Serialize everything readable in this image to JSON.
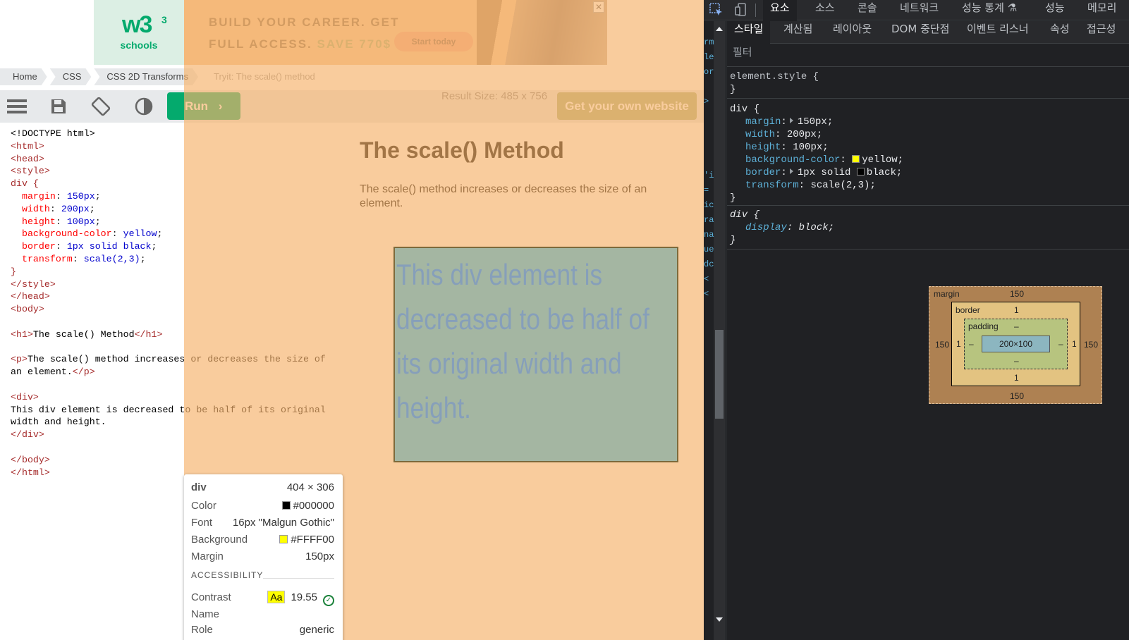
{
  "ad": {
    "logo_text": "w3",
    "logo_sup": "3",
    "logo_sub": "schools",
    "line1": "BUILD YOUR CAREER. GET",
    "line2": "FULL ACCESS.",
    "line2_save": "SAVE 770$",
    "cta": "Start today",
    "close": "✕"
  },
  "breadcrumb": [
    "Home",
    "CSS",
    "CSS 2D Transforms",
    "Tryit: The scale() method"
  ],
  "toolbar": {
    "run_label": "Run",
    "run_chevron": "›",
    "result_size": "Result Size: 485 x 756",
    "get_website": "Get your own website"
  },
  "code": {
    "l1": "<!DOCTYPE html>",
    "l2": "<html>",
    "l3": "<head>",
    "l4": "<style>",
    "l5": "div {",
    "l6p": "margin",
    "l6v": "150px",
    "l7p": "width",
    "l7v": "200px",
    "l8p": "height",
    "l8v": "100px",
    "l9p": "background-color",
    "l9v": "yellow",
    "l10p": "border",
    "l10v": "1px solid black",
    "l11p": "transform",
    "l11v": "scale(2,3)",
    "l12": "}",
    "l13": "</style>",
    "l14": "</head>",
    "l15": "<body>",
    "l16a": "<h1>",
    "l16b": "The scale() Method",
    "l16c": "</h1>",
    "l17a": "<p>",
    "l17b": "The scale() method increases or decreases the size of",
    "l18a": "an element.",
    "l18b": "</p>",
    "l19": "<div>",
    "l20": "This div element is decreased to be half of its original",
    "l21": "width and height.",
    "l22": "</div>",
    "l23": "</body>",
    "l24": "</html>"
  },
  "result": {
    "heading": "The scale() Method",
    "paragraph": "The scale() method increases or decreases the size of an element.",
    "div_text": "This div element is decreased to be half of its original width and height."
  },
  "tooltip": {
    "tag": "div",
    "dims": "404 × 306",
    "color_label": "Color",
    "color_value": "#000000",
    "font_label": "Font",
    "font_value": "16px \"Malgun Gothic\"",
    "bg_label": "Background",
    "bg_value": "#FFFF00",
    "margin_label": "Margin",
    "margin_value": "150px",
    "accessibility": "ACCESSIBILITY",
    "contrast_label": "Contrast",
    "contrast_chip": "Aa",
    "contrast_value": "19.55",
    "name_label": "Name",
    "role_label": "Role",
    "role_value": "generic",
    "colors": {
      "color": "#000000",
      "background": "#FFFF00"
    }
  },
  "devtools": {
    "top_tabs": [
      "요소",
      "소스",
      "콘솔",
      "네트워크",
      "성능 통계 ⚗",
      "성능",
      "메모리"
    ],
    "sub_tabs": [
      "스타일",
      "계산됨",
      "레이아웃",
      "DOM 중단점",
      "이벤트 리스너",
      "속성",
      "접근성"
    ],
    "filter_placeholder": "필터",
    "rule0_selector": "element.style {",
    "rule0_close": "}",
    "rule1_selector": "div {",
    "rule1": [
      {
        "name": "margin",
        "value": "150px;",
        "expand": true
      },
      {
        "name": "width",
        "value": "200px;"
      },
      {
        "name": "height",
        "value": "100px;"
      },
      {
        "name": "background-color",
        "value": "yellow;",
        "swatch": "#ffff00"
      },
      {
        "name": "border",
        "value": "1px solid",
        "value2": "black;",
        "expand": true,
        "swatch": "#000000"
      },
      {
        "name": "transform",
        "value": "scale(2,3);"
      }
    ],
    "rule1_close": "}",
    "rule2_selector": "div {",
    "rule2_name": "display",
    "rule2_value": "block;",
    "rule2_close": "}",
    "box_model": {
      "margin_label": "margin",
      "margin_top": "150",
      "margin_right": "150",
      "margin_bottom": "150",
      "margin_left": "150",
      "border_label": "border",
      "border_top": "1",
      "border_right": "1",
      "border_bottom": "1",
      "border_left": "1",
      "padding_label": "padding",
      "padding_top": "–",
      "padding_right": "–",
      "padding_bottom": "–",
      "padding_left": "–",
      "content": "200×100"
    }
  }
}
